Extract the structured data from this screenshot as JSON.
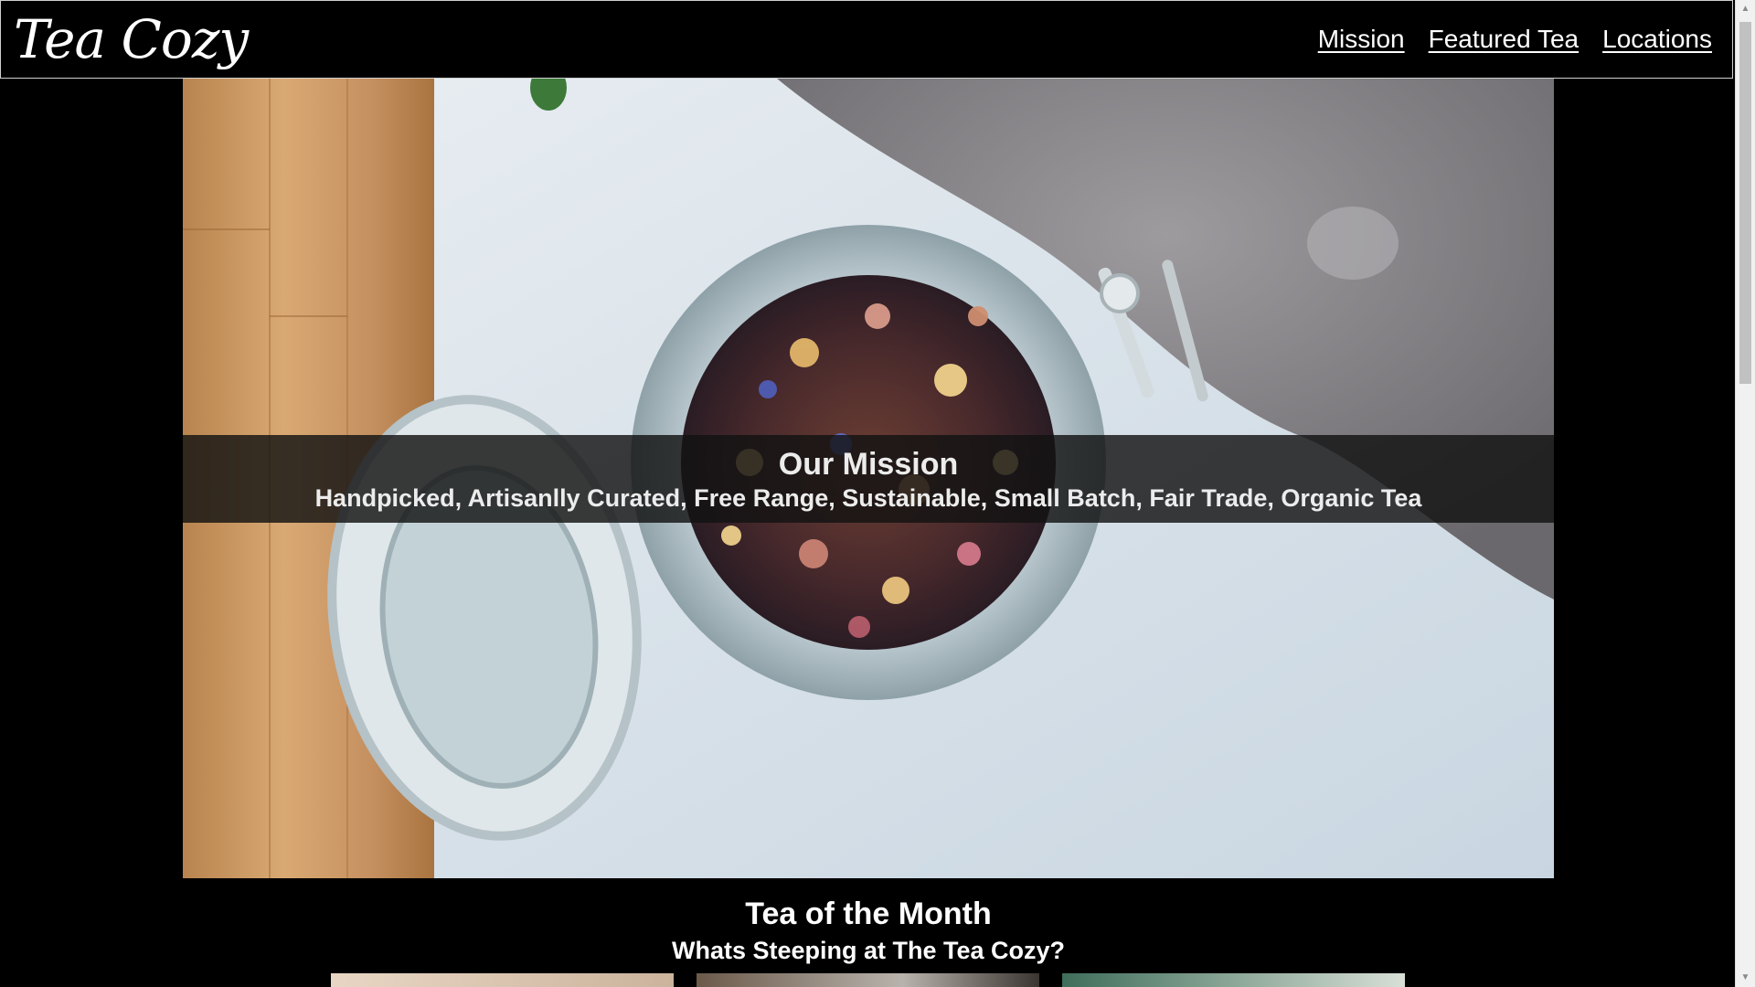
{
  "header": {
    "logo_text": "Tea Cozy",
    "nav": {
      "mission": "Mission",
      "featured": "Featured Tea",
      "locations": "Locations"
    }
  },
  "hero": {
    "image": "loose-leaf-tea-jar-photo",
    "mission_title": "Our Mission",
    "mission_text": "Handpicked, Artisanlly Curated, Free Range, Sustainable, Small Batch, Fair Trade, Organic Tea"
  },
  "tea_of_month": {
    "title": "Tea of the Month",
    "subtitle": "Whats Steeping at The Tea Cozy?",
    "thumbnails": [
      "tea-thumbnail-1",
      "tea-thumbnail-2",
      "tea-thumbnail-3"
    ]
  },
  "colors": {
    "background": "#000000",
    "text": "#ffffff",
    "band": "#121212"
  }
}
